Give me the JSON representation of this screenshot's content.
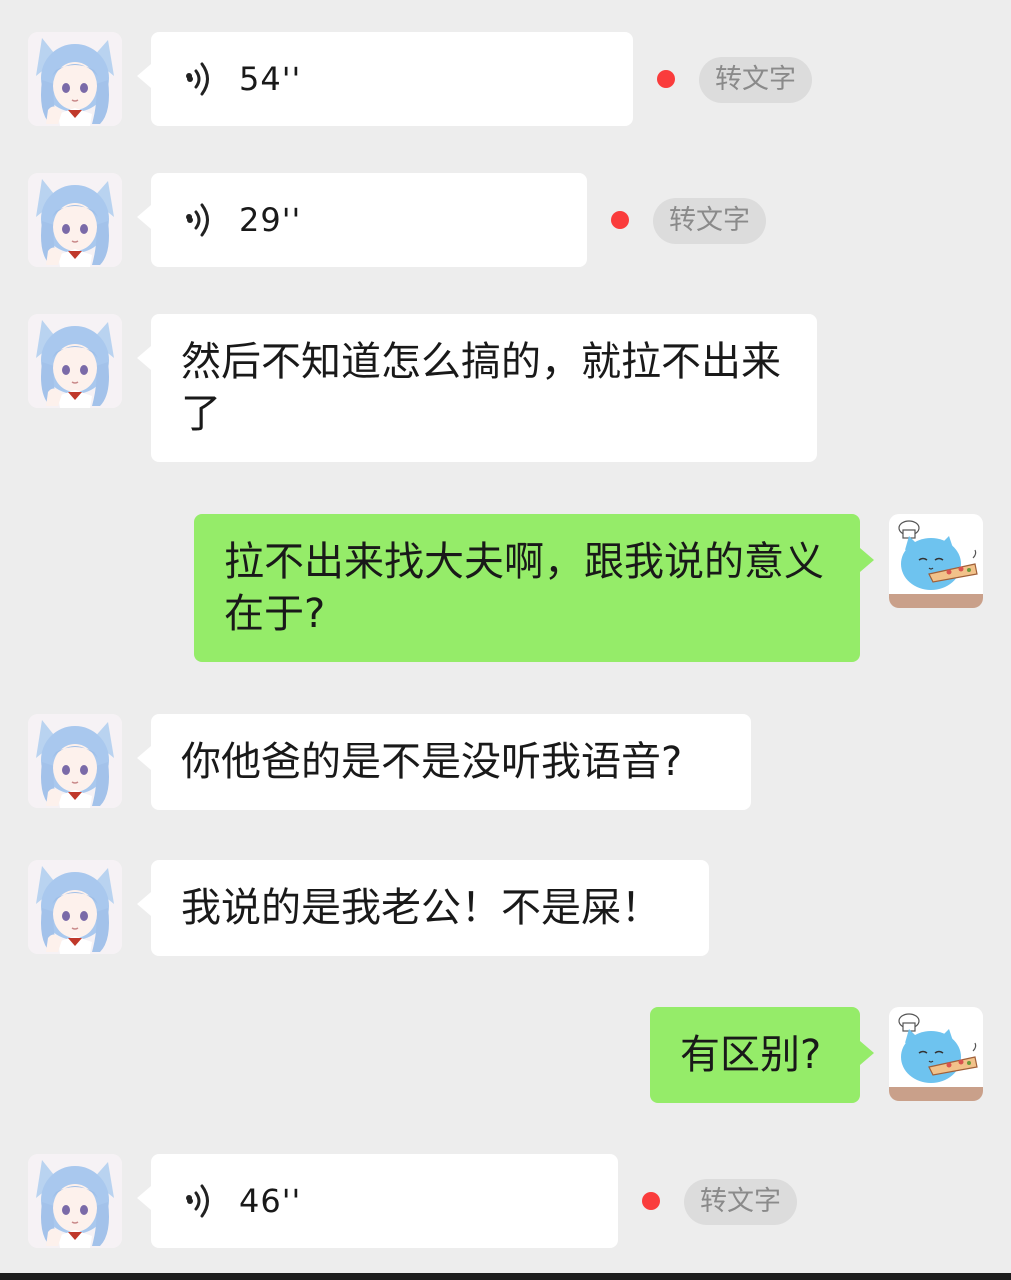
{
  "colors": {
    "background": "#ededed",
    "incoming_bubble": "#ffffff",
    "outgoing_bubble": "#95ec69",
    "unread_dot": "#fa3c3c",
    "transcribe_pill": "#dcdcdc"
  },
  "messages": [
    {
      "type": "voice",
      "direction": "incoming",
      "duration": "54''",
      "transcribe_label": "转文字",
      "unread": true
    },
    {
      "type": "voice",
      "direction": "incoming",
      "duration": "29''",
      "transcribe_label": "转文字",
      "unread": true
    },
    {
      "type": "text",
      "direction": "incoming",
      "text": "然后不知道怎么搞的，就拉不出来了"
    },
    {
      "type": "text",
      "direction": "outgoing",
      "text": "拉不出来找大夫啊，跟我说的意义在于?"
    },
    {
      "type": "text",
      "direction": "incoming",
      "text": "你他爸的是不是没听我语音?"
    },
    {
      "type": "text",
      "direction": "incoming",
      "text": "我说的是我老公！不是屎！"
    },
    {
      "type": "text",
      "direction": "outgoing",
      "text": "有区别?"
    },
    {
      "type": "voice",
      "direction": "incoming",
      "duration": "46''",
      "transcribe_label": "转文字",
      "unread": true
    }
  ],
  "icons": {
    "voice": "voice-wave-icon",
    "incoming_avatar": "anime-girl-avatar",
    "outgoing_avatar": "blue-cat-chef-avatar"
  }
}
